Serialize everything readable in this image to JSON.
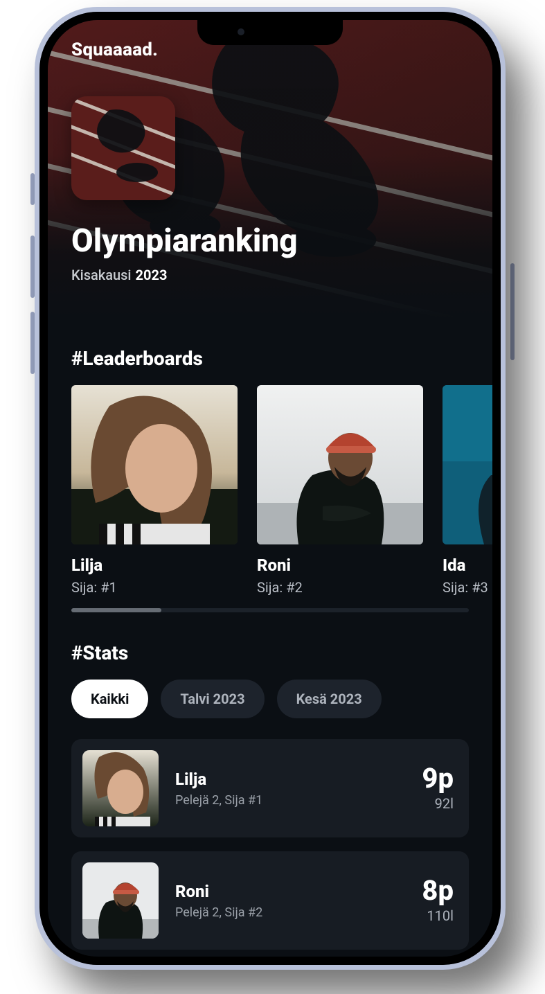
{
  "brand": "Squaaaad.",
  "header": {
    "title": "Olympiaranking",
    "season_label": "Kisakausi",
    "season_year": "2023"
  },
  "leaderboards": {
    "heading": "#Leaderboards",
    "rank_prefix": "Sija: #",
    "items": [
      {
        "name": "Lilja",
        "rank": "1"
      },
      {
        "name": "Roni",
        "rank": "2"
      },
      {
        "name": "Ida",
        "rank": "3"
      }
    ]
  },
  "stats": {
    "heading": "#Stats",
    "filters": [
      {
        "label": "Kaikki",
        "active": true
      },
      {
        "label": "Talvi 2023",
        "active": false
      },
      {
        "label": "Kesä 2023",
        "active": false
      }
    ],
    "rows": [
      {
        "name": "Lilja",
        "meta": "Pelejä 2, Sija #1",
        "points": "9p",
        "sub": "92l"
      },
      {
        "name": "Roni",
        "meta": "Pelejä 2, Sija #2",
        "points": "8p",
        "sub": "110l"
      }
    ]
  }
}
